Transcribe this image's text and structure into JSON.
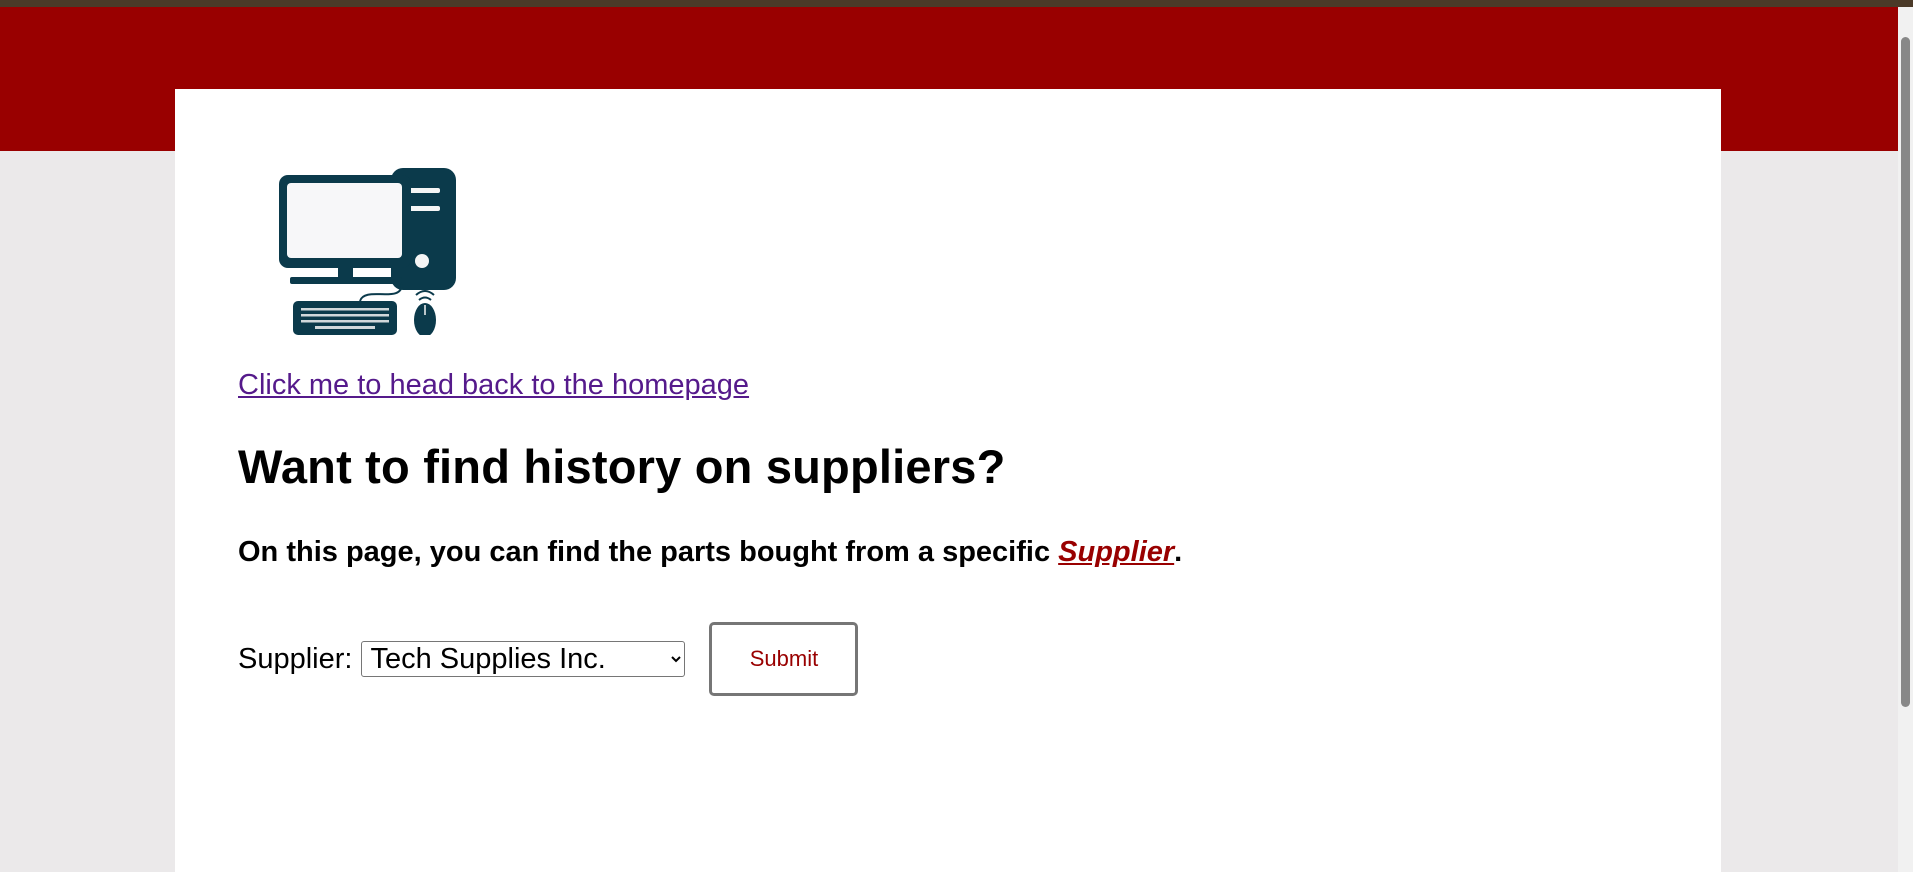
{
  "page": {
    "home_link": "Click me to head back to the homepage",
    "title": "Want to find history on suppliers?",
    "intro_text": "On this page, you can find the parts bought from a specific ",
    "intro_link": "Supplier",
    "intro_end": "."
  },
  "form": {
    "supplier_label": "Supplier:",
    "supplier_selected": "Tech Supplies Inc.",
    "submit_label": "Submit"
  },
  "colors": {
    "brand": "#990000",
    "visited_link": "#551a8b",
    "logo": "#0b3a4b"
  },
  "icons": {
    "logo": "desktop-computer-icon"
  }
}
